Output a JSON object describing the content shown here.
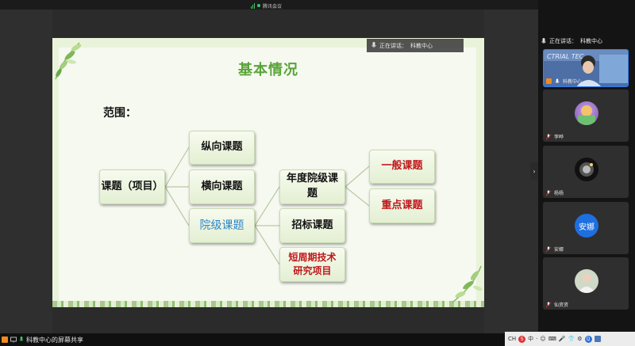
{
  "app": {
    "top_indicator": "腾讯会议",
    "share_label": "科教中心的屏幕共享"
  },
  "slide": {
    "title": "基本情况",
    "scope": "范围：",
    "root": "课题（项目）",
    "level1": [
      "纵向课题",
      "横向课题",
      "院级课题"
    ],
    "level2": [
      "年度院级课题",
      "招标课题",
      "短周期技术研究项目"
    ],
    "level3": [
      "一般课题",
      "重点课题"
    ]
  },
  "speaking": {
    "prefix": "正在讲话：",
    "name": "科教中心"
  },
  "participants": [
    {
      "name": "科教中心",
      "kind": "video"
    },
    {
      "name": "李晔",
      "kind": "avatar"
    },
    {
      "name": "杨杨",
      "kind": "avatar"
    },
    {
      "name": "安娜",
      "kind": "text-avatar",
      "avatar_text": "安娜"
    },
    {
      "name": "仙资资",
      "kind": "avatar"
    }
  ],
  "tray": {
    "items": [
      "CH",
      "S",
      "中",
      "·",
      "☺",
      "⌨",
      "🎤",
      "👕",
      "⚙"
    ]
  },
  "colors": {
    "title_green": "#5aa43a",
    "blue_text": "#2f86c8",
    "red_text": "#c0161b",
    "active_border": "#2f7df6"
  }
}
